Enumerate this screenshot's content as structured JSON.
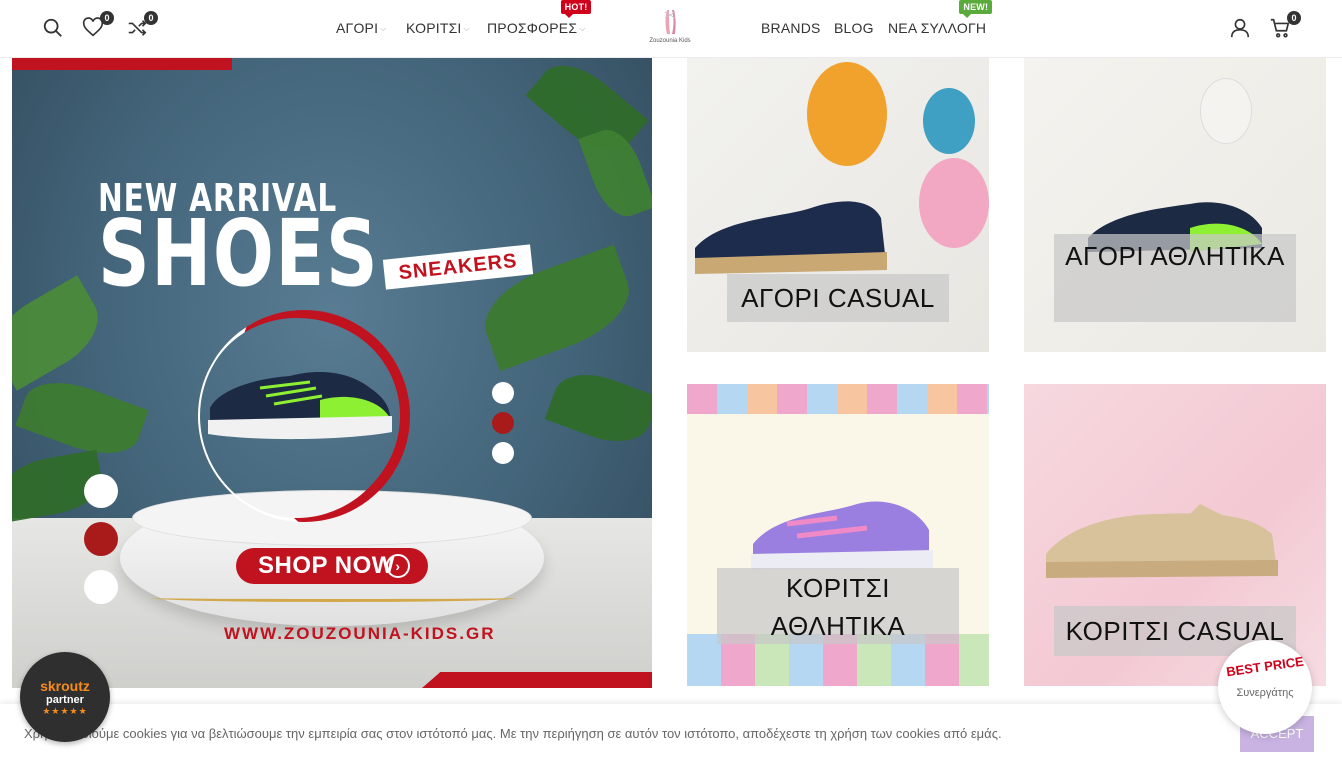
{
  "header": {
    "nav_left": [
      {
        "label": "ΑΓΟΡΙ",
        "dropdown": true
      },
      {
        "label": "ΚΟΡΙΤΣΙ",
        "dropdown": true
      },
      {
        "label": "ΠΡΟΣΦΟΡΕΣ",
        "dropdown": true,
        "tag": "HOT!"
      }
    ],
    "nav_right": [
      {
        "label": "BRANDS"
      },
      {
        "label": "BLOG"
      },
      {
        "label": "ΝΕΑ ΣΥΛΛΟΓΗ",
        "tag": "NEW!"
      }
    ],
    "logo_text": "Zouzounia Kids",
    "wishlist_count": "0",
    "compare_count": "0",
    "cart_count": "0"
  },
  "hero": {
    "title_line1": "NEW ARRIVAL",
    "title_line2": "SHOES",
    "tag": "SNEAKERS",
    "cta": "SHOP NOW",
    "url": "WWW.ZOUZOUNIA-KIDS.GR"
  },
  "tiles": [
    {
      "label": "ΑΓΟΡΙ CASUAL"
    },
    {
      "label": "ΑΓΟΡΙ ΑΘΛΗΤΙΚΑ"
    },
    {
      "label": "ΚΟΡΙΤΣΙ ΑΘΛΗΤΙΚΑ"
    },
    {
      "label": "ΚΟΡΙΤΣΙ CASUAL"
    }
  ],
  "cookie": {
    "text": "Χρησιμοποιούμε cookies για να βελτιώσουμε την εμπειρία σας στον ιστότοπό μας. Με την περιήγηση σε αυτόν τον ιστότοπο, αποδέχεστε τη χρήση των cookies από εμάς.",
    "accept": "ACCEPT"
  },
  "badges": {
    "skroutz_1": "skroutz",
    "skroutz_2": "partner",
    "skroutz_3": "★★★★★",
    "bestprice_1": "BEST PRICE",
    "bestprice_2": "Συνεργάτης"
  },
  "colors": {
    "brand_red": "#c1121f",
    "hot_tag": "#d0021b",
    "new_tag": "#5aaa3c",
    "accept_bg": "#c9b3e3"
  }
}
